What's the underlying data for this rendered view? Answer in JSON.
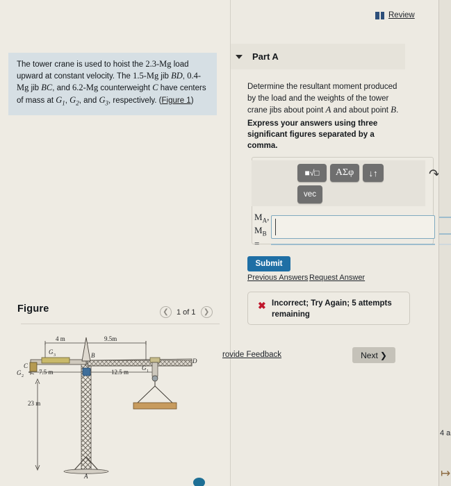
{
  "left": {
    "question": {
      "line1_a": "The tower crane is used to hoist the ",
      "load": "2.3-Mg",
      "line1_b": " load upward at constant velocity. The ",
      "jib1": "1.5-Mg",
      "jib1_lbl": " jib ",
      "bd": "BD",
      "sep1": ", ",
      "jib2": "0.4-Mg",
      "jib2_lbl": " jib ",
      "bc": "BC",
      "sep2": ", and ",
      "cw": "6.2-Mg",
      "cw_lbl": " counterweight ",
      "c": "C",
      "tail": " have centers of mass at ",
      "g1": "G",
      "g1s": "1",
      "g2": "G",
      "g2s": "2",
      "g3": "G",
      "g3s": "3",
      "resp": ", respectively. (",
      "figure_link": "Figure 1",
      "close": ")"
    },
    "figure_title": "Figure",
    "pager": {
      "prev_icon": "chevron-left",
      "label": "1 of 1",
      "next_icon": "chevron-right"
    },
    "diagram": {
      "dim_4m": "4 m",
      "dim_95m": "9.5m",
      "dim_75m": "7.5 m",
      "dim_125m": "12.5 m",
      "dim_23m": "23 m",
      "pt_A": "A",
      "pt_B": "B",
      "pt_C": "C",
      "pt_D": "D",
      "lbl_G1": "G",
      "lbl_G1_sub": "1",
      "lbl_G2": "G",
      "lbl_G2_sub": "2",
      "lbl_G3": "G",
      "lbl_G3_sub": "3"
    }
  },
  "right": {
    "review_label": "Review",
    "review_icon": "book-icon",
    "part_title": "Part A",
    "caret_icon": "caret-down-icon",
    "prompt": {
      "t1": "Determine the resultant moment produced by the load and the weights of the tower crane jibs about point ",
      "A": "A",
      "t2": " and about point ",
      "B": "B",
      "t3": "."
    },
    "instruction": "Express your answers using three significant figures separated by a comma.",
    "mathbar": {
      "root_label": "■√□",
      "greek_label": "ΑΣφ",
      "updown_label": "↓↑",
      "vec_label": "vec",
      "undo_label": "↶"
    },
    "answer": {
      "label_MA": "M",
      "label_MA_sub": "A",
      "label_comma": ",",
      "label_MB": "M",
      "label_MB_sub": "B",
      "label_eq": "=",
      "value": "",
      "placeholder": ""
    },
    "submit_label": "Submit",
    "previous_answers_label": "Previous Answers",
    "request_answer_label": "Request Answer",
    "feedback": {
      "icon": "x-mark-icon",
      "text": "Incorrect; Try Again; 5 attempts remaining"
    },
    "provide_feedback_label": "rovide Feedback",
    "next_label": "Next",
    "next_icon": "chevron-right-icon"
  },
  "sliver": {
    "text": "4 a",
    "arrow": "↦"
  },
  "colors": {
    "page_bg": "#eae7df",
    "question_bg": "#d6dfe4",
    "submit_blue": "#1f6fa5",
    "error_red": "#c0172c",
    "input_border": "#7fa9bf",
    "next_gray": "#c5c2b9"
  }
}
